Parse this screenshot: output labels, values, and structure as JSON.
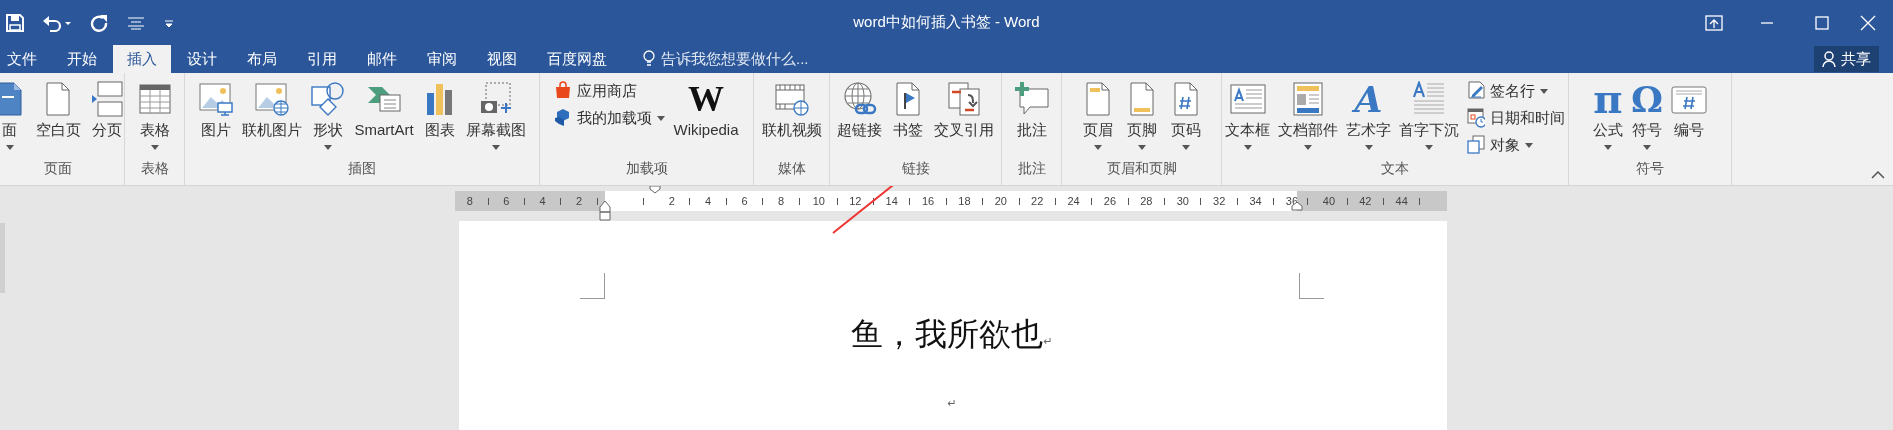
{
  "window": {
    "title": "word中如何插入书签 - Word"
  },
  "tabs": [
    {
      "label": "文件",
      "selected": false
    },
    {
      "label": "开始",
      "selected": false
    },
    {
      "label": "插入",
      "selected": true
    },
    {
      "label": "设计",
      "selected": false
    },
    {
      "label": "布局",
      "selected": false
    },
    {
      "label": "引用",
      "selected": false
    },
    {
      "label": "邮件",
      "selected": false
    },
    {
      "label": "审阅",
      "selected": false
    },
    {
      "label": "视图",
      "selected": false
    },
    {
      "label": "百度网盘",
      "selected": false
    }
  ],
  "tell_me": {
    "placeholder": "告诉我您想要做什么..."
  },
  "share": {
    "label": "共享"
  },
  "ribbon": {
    "groups": [
      {
        "label": "页面",
        "items": [
          {
            "kind": "large",
            "label": "面",
            "dropdown": true
          },
          {
            "kind": "large",
            "label": "空白页",
            "dropdown": false
          },
          {
            "kind": "large",
            "label": "分页",
            "dropdown": false
          }
        ]
      },
      {
        "label": "表格",
        "items": [
          {
            "kind": "large",
            "label": "表格",
            "dropdown": true
          }
        ]
      },
      {
        "label": "插图",
        "items": [
          {
            "kind": "large",
            "label": "图片",
            "dropdown": false
          },
          {
            "kind": "large",
            "label": "联机图片",
            "dropdown": false
          },
          {
            "kind": "large",
            "label": "形状",
            "dropdown": true
          },
          {
            "kind": "large",
            "label": "SmartArt",
            "dropdown": false
          },
          {
            "kind": "large",
            "label": "图表",
            "dropdown": false
          },
          {
            "kind": "large",
            "label": "屏幕截图",
            "dropdown": true
          }
        ]
      },
      {
        "label": "加载项",
        "items": [
          {
            "kind": "small",
            "label": "应用商店",
            "dropdown": false
          },
          {
            "kind": "small",
            "label": "我的加载项",
            "dropdown": true
          },
          {
            "kind": "glyph",
            "glyph": "W",
            "label": "Wikipedia",
            "dropdown": false
          }
        ]
      },
      {
        "label": "媒体",
        "items": [
          {
            "kind": "large",
            "label": "联机视频",
            "dropdown": false
          }
        ]
      },
      {
        "label": "链接",
        "items": [
          {
            "kind": "large",
            "label": "超链接",
            "dropdown": false
          },
          {
            "kind": "large",
            "label": "书签",
            "dropdown": false
          },
          {
            "kind": "large",
            "label": "交叉引用",
            "dropdown": false
          }
        ]
      },
      {
        "label": "批注",
        "items": [
          {
            "kind": "large",
            "label": "批注",
            "dropdown": false
          }
        ]
      },
      {
        "label": "页眉和页脚",
        "items": [
          {
            "kind": "large",
            "label": "页眉",
            "dropdown": true
          },
          {
            "kind": "large",
            "label": "页脚",
            "dropdown": true
          },
          {
            "kind": "large",
            "label": "页码",
            "dropdown": true
          }
        ]
      },
      {
        "label": "文本",
        "items": [
          {
            "kind": "large",
            "label": "文本框",
            "dropdown": true
          },
          {
            "kind": "large",
            "label": "文档部件",
            "dropdown": true
          },
          {
            "kind": "glyph",
            "glyph": "A",
            "label": "艺术字",
            "dropdown": true
          },
          {
            "kind": "large",
            "label": "首字下沉",
            "dropdown": true
          },
          {
            "kind": "small",
            "label": "签名行",
            "dropdown": true
          },
          {
            "kind": "small",
            "label": "日期和时间",
            "dropdown": false
          },
          {
            "kind": "small",
            "label": "对象",
            "dropdown": true
          }
        ]
      },
      {
        "label": "符号",
        "items": [
          {
            "kind": "glyph",
            "glyph": "π",
            "label": "公式",
            "dropdown": true
          },
          {
            "kind": "glyph",
            "glyph": "Ω",
            "label": "符号",
            "dropdown": true
          },
          {
            "kind": "large",
            "label": "编号",
            "dropdown": false
          }
        ]
      }
    ]
  },
  "ruler": {
    "left_numbers": [
      "8",
      "6",
      "4",
      "2"
    ],
    "numbers": [
      "2",
      "4",
      "6",
      "8",
      "10",
      "12",
      "14",
      "16",
      "18",
      "20",
      "22",
      "24",
      "26",
      "28",
      "30",
      "32",
      "34",
      "36"
    ],
    "right_numbers": [
      "40",
      "42",
      "44"
    ]
  },
  "document": {
    "paragraphs": [
      {
        "text": "鱼，我所欲也",
        "mark": "↵"
      },
      {
        "mark": "↵"
      }
    ]
  }
}
